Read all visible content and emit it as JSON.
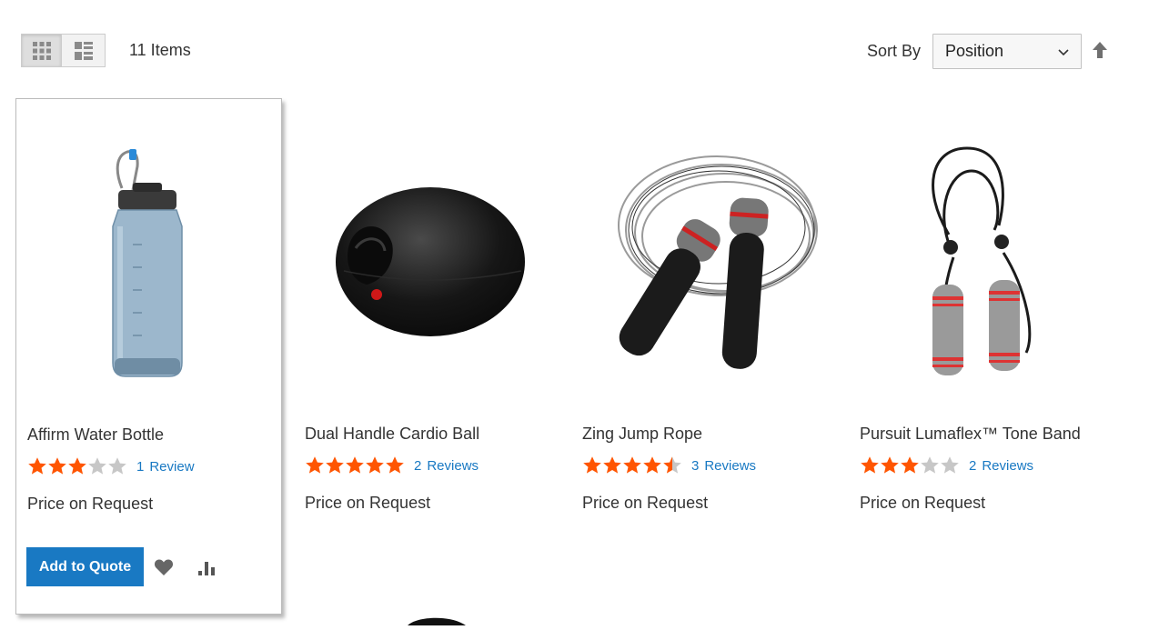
{
  "toolbar": {
    "modes": [
      {
        "label": "Grid",
        "icon": "grid-icon",
        "active": true
      },
      {
        "label": "List",
        "icon": "list-icon",
        "active": false
      }
    ],
    "items_count": "11 Items",
    "sort_label": "Sort By",
    "sort_value": "Position",
    "sort_direction_icon": "arrow-up-icon"
  },
  "colors": {
    "accent": "#1979c3",
    "star_filled": "#ff5501",
    "star_empty": "#c7c7c7"
  },
  "products": [
    {
      "name": "Affirm Water Bottle",
      "rating": 3,
      "review_count": "1",
      "review_word": "Review",
      "price": "Price on Request"
    },
    {
      "name": "Dual Handle Cardio Ball",
      "rating": 5,
      "review_count": "2",
      "review_word": "Reviews",
      "price": "Price on Request"
    },
    {
      "name": "Zing Jump Rope",
      "rating": 4.5,
      "review_count": "3",
      "review_word": "Reviews",
      "price": "Price on Request"
    },
    {
      "name": "Pursuit Lumaflex™ Tone Band",
      "rating": 3,
      "review_count": "2",
      "review_word": "Reviews",
      "price": "Price on Request"
    }
  ],
  "actions": {
    "add_to_quote": "Add to Quote",
    "wishlist_icon": "heart-icon",
    "compare_icon": "bar-chart-icon"
  }
}
